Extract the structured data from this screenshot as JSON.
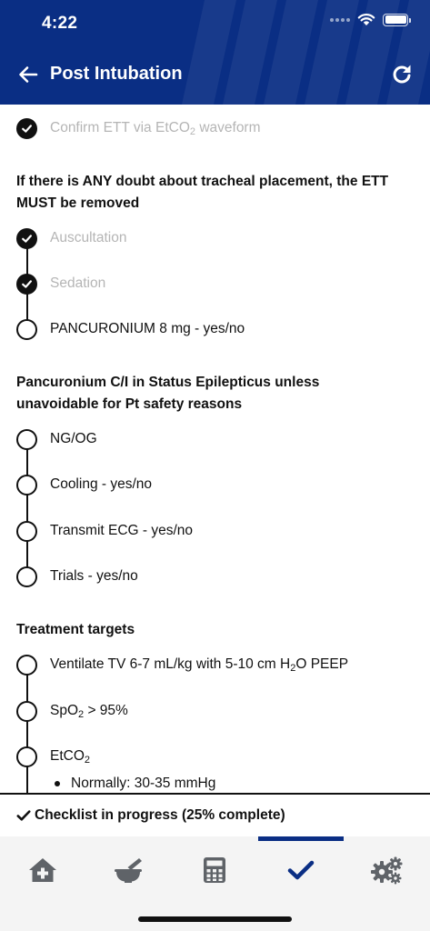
{
  "status_bar": {
    "time": "4:22"
  },
  "header": {
    "title": "Post Intubation",
    "back_icon": "arrow-left-icon",
    "refresh_icon": "refresh-icon"
  },
  "checklist": {
    "item_confirm_prefix": "Confirm ETT via EtCO",
    "item_confirm_sub": "2",
    "item_confirm_suffix": " waveform",
    "warning_placement": "If there is ANY doubt about tracheal placement, the ETT MUST be removed",
    "auscultation": "Auscultation",
    "sedation": "Sedation",
    "pancuronium": "PANCURONIUM 8 mg - yes/no",
    "warning_pancuronium": "Pancuronium C/I in Status Epilepticus unless unavoidable for Pt safety reasons",
    "ng_og": "NG/OG",
    "cooling": "Cooling - yes/no",
    "transmit_ecg": "Transmit ECG - yes/no",
    "trials": "Trials - yes/no",
    "treatment_targets": "Treatment targets",
    "ventilate_prefix": "Ventilate TV 6-7 mL/kg with 5-10 cm H",
    "ventilate_sub": "2",
    "ventilate_suffix": "O PEEP",
    "spo2_prefix": "SpO",
    "spo2_sub": "2",
    "spo2_suffix": " > 95%",
    "etco2_prefix": "EtCO",
    "etco2_sub": "2",
    "etco2_normal": "Normally: 30-35 mmHg"
  },
  "progress": {
    "text": "Checklist in progress (25% complete)",
    "percent": 25
  },
  "tabbar": {
    "tabs": [
      {
        "icon": "home-medical-icon",
        "active": false
      },
      {
        "icon": "mortar-pestle-icon",
        "active": false
      },
      {
        "icon": "calculator-icon",
        "active": false
      },
      {
        "icon": "checkmark-icon",
        "active": true
      },
      {
        "icon": "gears-icon",
        "active": false
      }
    ]
  },
  "colors": {
    "brand": "#0a2e84",
    "done_text": "#b5b5b5",
    "icon_gray": "#5f6368"
  }
}
